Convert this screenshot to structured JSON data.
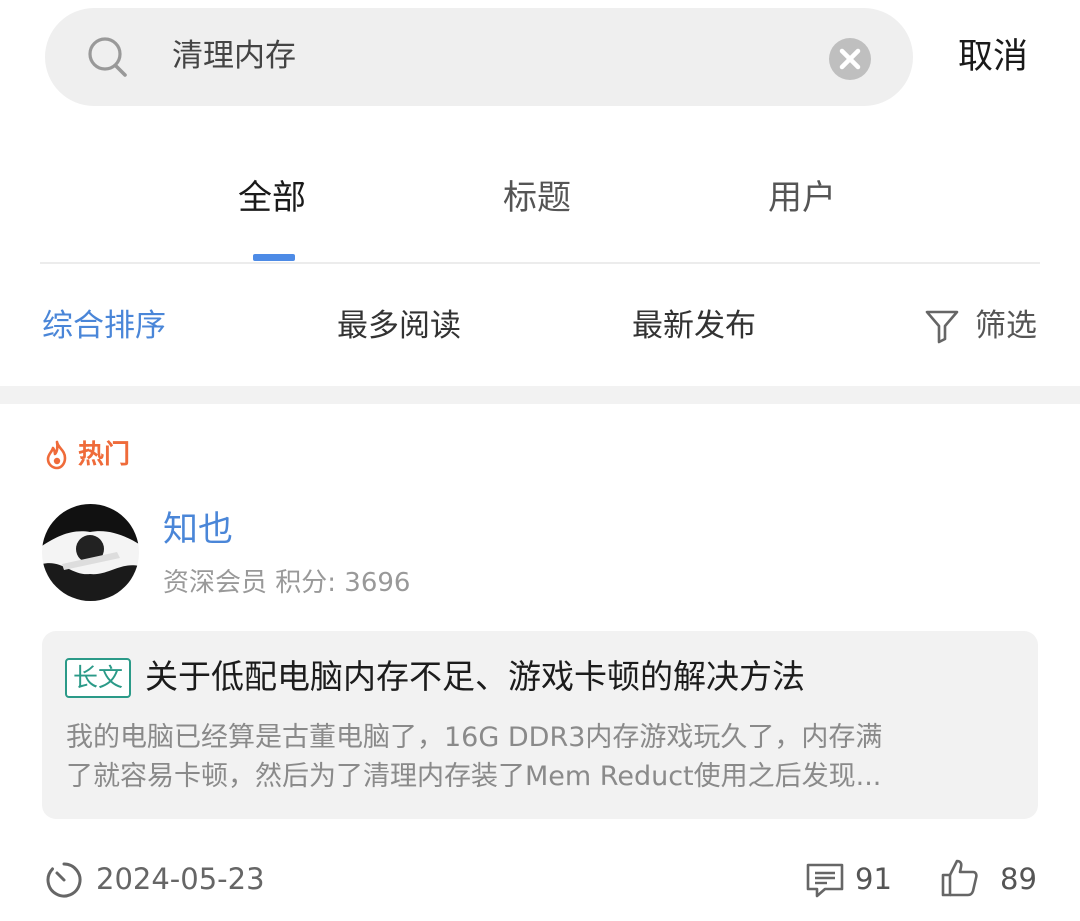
{
  "search": {
    "query": "清理内存",
    "cancel_label": "取消"
  },
  "tabs": [
    {
      "label": "全部",
      "active": true
    },
    {
      "label": "标题",
      "active": false
    },
    {
      "label": "用户",
      "active": false
    }
  ],
  "sort": {
    "options": [
      {
        "label": "综合排序",
        "active": true
      },
      {
        "label": "最多阅读",
        "active": false
      },
      {
        "label": "最新发布",
        "active": false
      }
    ],
    "filter_label": "筛选"
  },
  "post": {
    "hot_label": "热门",
    "author": {
      "name": "知也",
      "meta": "资深会员 积分: 3696"
    },
    "tag": "长文",
    "title": "关于低配电脑内存不足、游戏卡顿的解决方法",
    "excerpt_lines": [
      "我的电脑已经算是古董电脑了，16G DDR3内存游戏玩久了，内存满",
      "了就容易卡顿，然后为了清理内存装了Mem Reduct使用之后发现..."
    ],
    "date": "2024-05-23",
    "comments": "91",
    "likes": "89"
  },
  "colors": {
    "accent": "#4a86d8",
    "hot": "#ef6b3a",
    "tag": "#2b9a88",
    "card_bg": "#f2f2f2"
  },
  "icons": {
    "search": "search-icon",
    "clear": "clear-icon",
    "filter": "filter-icon",
    "hot": "flame-icon",
    "clock": "clock-icon",
    "comment": "comment-icon",
    "like": "thumbs-up-icon"
  }
}
